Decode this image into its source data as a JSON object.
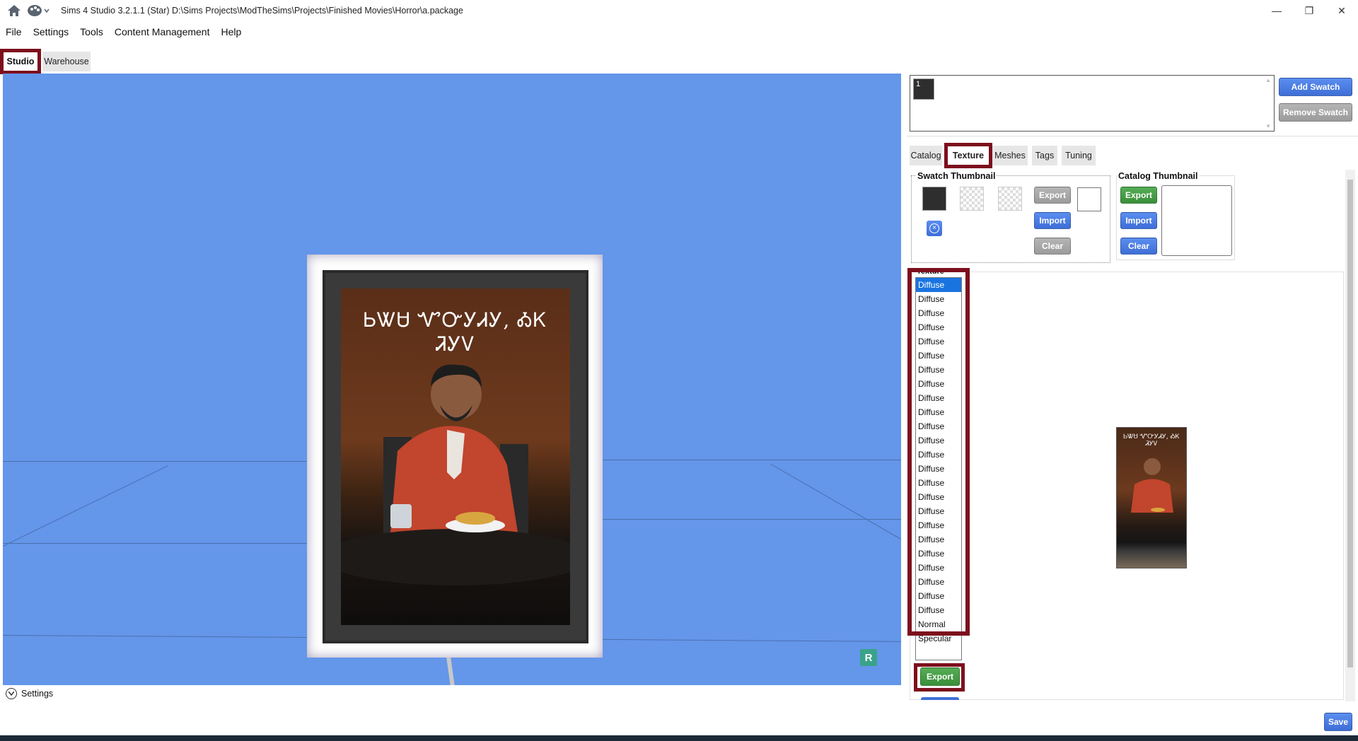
{
  "window": {
    "title": "Sims 4 Studio 3.2.1.1 (Star)  D:\\Sims Projects\\ModTheSims\\Projects\\Finished Movies\\Horror\\a.package",
    "minimize": "—",
    "restore": "❐",
    "close": "✕"
  },
  "icons": {
    "home": "home-icon",
    "palette": "palette-icon",
    "settings_toggle": "chevron-circle-icon",
    "remove": "close-circle-icon"
  },
  "menu": [
    "File",
    "Settings",
    "Tools",
    "Content Management",
    "Help"
  ],
  "app_tabs": {
    "studio": "Studio",
    "warehouse": "Warehouse"
  },
  "viewport": {
    "poster_text": "ᏏᏔᏌ ᏉᏅᎩᏗᎩ, ᎣᏦ ᏘᎩᏙ",
    "badge": "R",
    "settings_label": "Settings",
    "background": "#6496ea"
  },
  "swatches": {
    "chips": [
      "1"
    ],
    "add_label": "Add Swatch",
    "remove_label": "Remove Swatch"
  },
  "tabs": [
    "Catalog",
    "Texture",
    "Meshes",
    "Tags",
    "Tuning"
  ],
  "active_tab": "Texture",
  "swatch_thumbnail": {
    "title": "Swatch Thumbnail",
    "export_label": "Export",
    "import_label": "Import",
    "clear_label": "Clear"
  },
  "catalog_thumbnail": {
    "title": "Catalog Thumbnail",
    "export_label": "Export",
    "import_label": "Import",
    "clear_label": "Clear"
  },
  "texture": {
    "header": "Texture",
    "items": [
      "Diffuse",
      "Diffuse",
      "Diffuse",
      "Diffuse",
      "Diffuse",
      "Diffuse",
      "Diffuse",
      "Diffuse",
      "Diffuse",
      "Diffuse",
      "Diffuse",
      "Diffuse",
      "Diffuse",
      "Diffuse",
      "Diffuse",
      "Diffuse",
      "Diffuse",
      "Diffuse",
      "Diffuse",
      "Diffuse",
      "Diffuse",
      "Diffuse",
      "Diffuse",
      "Diffuse",
      "Normal",
      "Specular"
    ],
    "selected_index": 0,
    "export_label": "Export",
    "preview_text": "ᏏᏔᏌ ᏉᏅᎩᏗᎩ, ᎣᏦ ᏘᎩᏙ"
  },
  "footer": {
    "save_label": "Save"
  },
  "colors": {
    "highlight": "#7d0f1d",
    "accent_blue": "#3e6ed6",
    "accent_green": "#3a8f3a",
    "selection": "#1a74e0"
  }
}
